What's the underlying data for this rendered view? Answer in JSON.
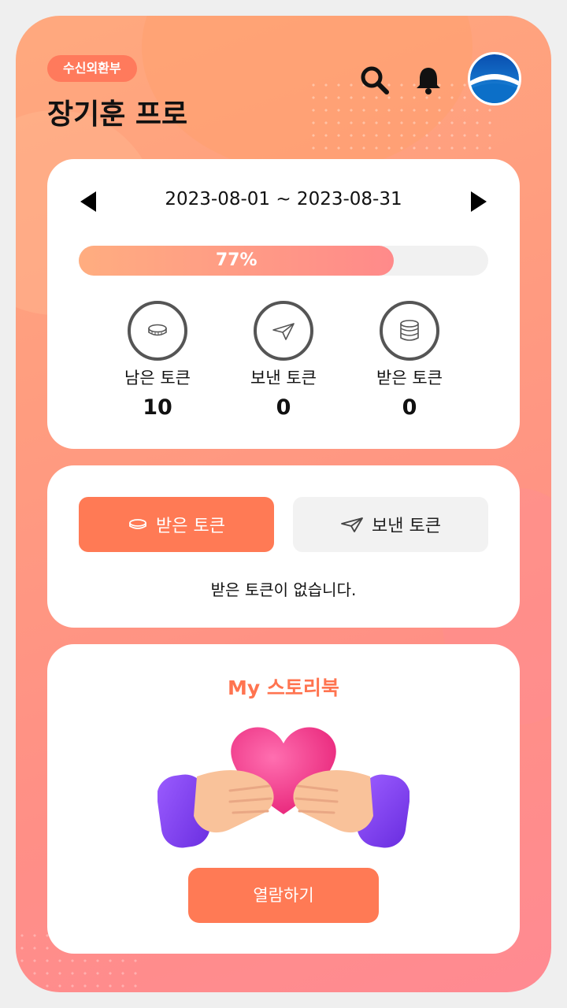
{
  "header": {
    "department": "수신외환부",
    "user_name": "장기훈 프로",
    "icons": [
      "search-icon",
      "bell-icon",
      "company-logo"
    ]
  },
  "summary": {
    "period": "2023-08-01 ~ 2023-08-31",
    "progress_percent": 77,
    "progress_label": "77%",
    "stats": [
      {
        "label": "남은 토큰",
        "value": "10",
        "icon": "coin-icon"
      },
      {
        "label": "보낸 토큰",
        "value": "0",
        "icon": "paper-plane-icon"
      },
      {
        "label": "받은 토큰",
        "value": "0",
        "icon": "coin-stack-icon"
      }
    ]
  },
  "tokens": {
    "tabs": [
      {
        "label": "받은 토큰",
        "icon": "coin-icon",
        "active": true
      },
      {
        "label": "보낸 토큰",
        "icon": "paper-plane-icon",
        "active": false
      }
    ],
    "empty_message": "받은 토큰이 없습니다."
  },
  "storybook": {
    "title": "My 스토리북",
    "button_label": "열람하기"
  },
  "colors": {
    "accent": "#ff7a55",
    "title_accent": "#ff7450",
    "progress_start": "#ffad80",
    "progress_end": "#ff8a8a"
  }
}
